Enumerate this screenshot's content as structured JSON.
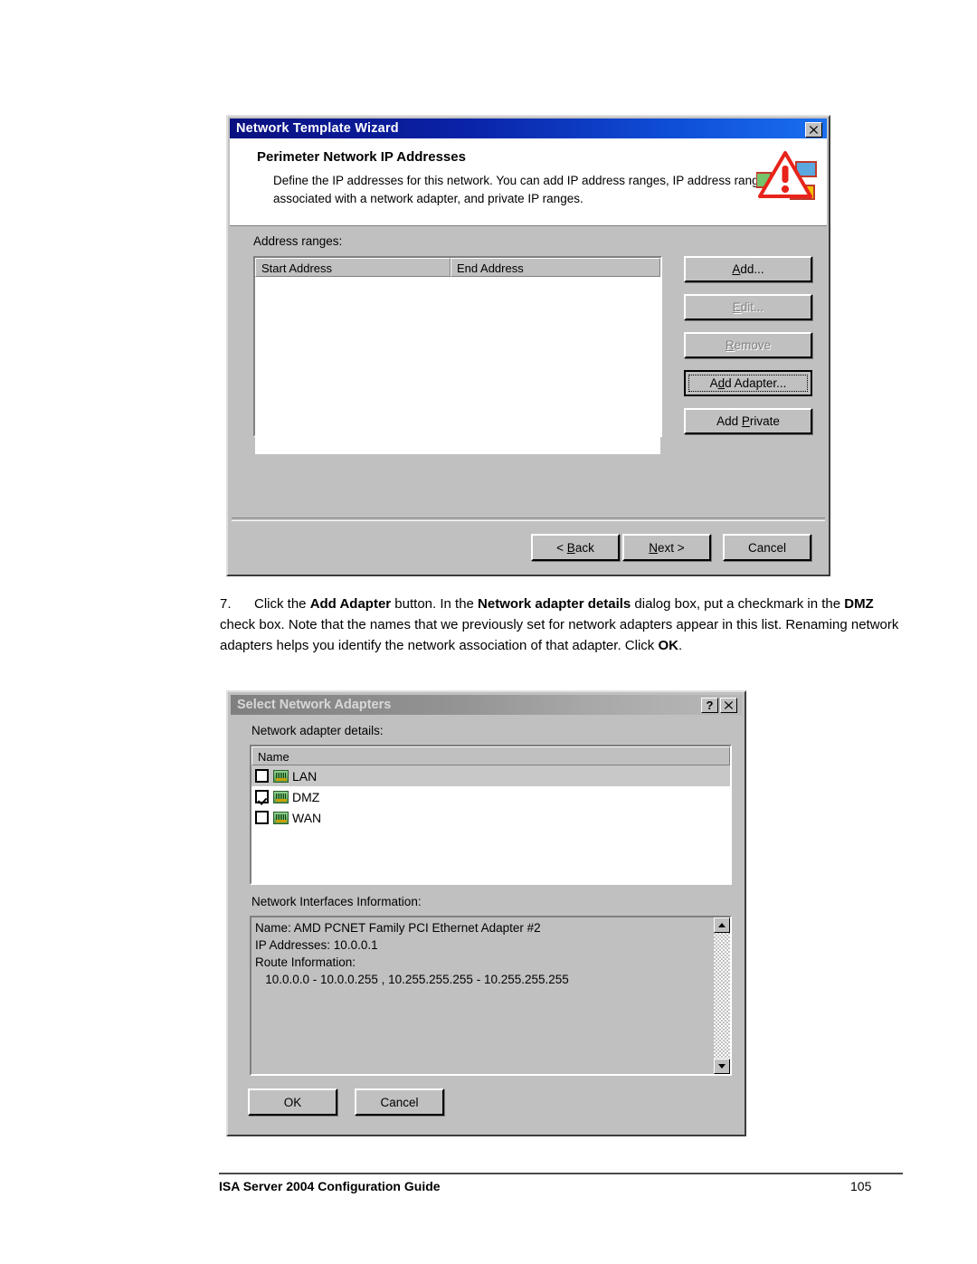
{
  "wizard": {
    "title": "Network Template Wizard",
    "close_label": "✕",
    "header": {
      "title": "Perimeter Network IP Addresses",
      "description": "Define the IP addresses for this network. You can add IP address ranges, IP address ranges associated with a network adapter, and private IP ranges.",
      "icon": "warning-triangle-network-icon"
    },
    "ranges_label": "Address ranges:",
    "columns": [
      "Start Address",
      "End Address"
    ],
    "rows": [],
    "side_buttons": [
      {
        "label": "Add...",
        "underline": "A",
        "state": "enabled"
      },
      {
        "label": "Edit...",
        "underline": "E",
        "state": "disabled"
      },
      {
        "label": "Remove",
        "underline": "R",
        "state": "disabled"
      },
      {
        "label": "Add Adapter...",
        "underline": "d",
        "state": "default"
      },
      {
        "label": "Add Private",
        "underline": "P",
        "state": "enabled"
      }
    ],
    "nav_buttons": [
      {
        "label": "< Back"
      },
      {
        "label": "Next >"
      },
      {
        "label": "Cancel"
      }
    ]
  },
  "step": {
    "number": "7.",
    "html": "Click the <b>Add Adapter</b> button. In the <b>Network adapter details</b> dialog box, put a checkmark in the <b>DMZ</b> check box. Note that the names that we previously set for network adapters appear in this list. Renaming network adapters helps you identify the network association of that adapter. Click <b>OK</b>."
  },
  "select_dialog": {
    "title": "Select Network Adapters",
    "help_label": "?",
    "close_label": "✕",
    "adapter_label": "Network adapter details:",
    "column_header": "Name",
    "adapters": [
      {
        "name": "LAN",
        "checked": false,
        "selected": true,
        "icon": "network-adapter-icon"
      },
      {
        "name": "DMZ",
        "checked": true,
        "selected": false,
        "icon": "network-adapter-icon"
      },
      {
        "name": "WAN",
        "checked": false,
        "selected": false,
        "icon": "network-adapter-icon"
      }
    ],
    "info_label": "Network Interfaces Information:",
    "info_text": "Name: AMD PCNET Family PCI Ethernet Adapter #2\nIP Addresses: 10.0.0.1\nRoute Information:\n   10.0.0.0 - 10.0.0.255 , 10.255.255.255 - 10.255.255.255",
    "buttons": [
      {
        "label": "OK"
      },
      {
        "label": "Cancel"
      }
    ]
  },
  "page_footer": {
    "left": "ISA Server 2004 Configuration Guide",
    "right": "105"
  },
  "colors": {
    "titlebar_active_start": "#0a1080",
    "titlebar_active_end": "#1a6ff0",
    "titlebar_inactive_start": "#808080",
    "titlebar_inactive_end": "#b8b8b8",
    "dialog_face": "#c0c0c0",
    "warning_red": "#e8231a",
    "nic_green": "#4f9a4f"
  }
}
